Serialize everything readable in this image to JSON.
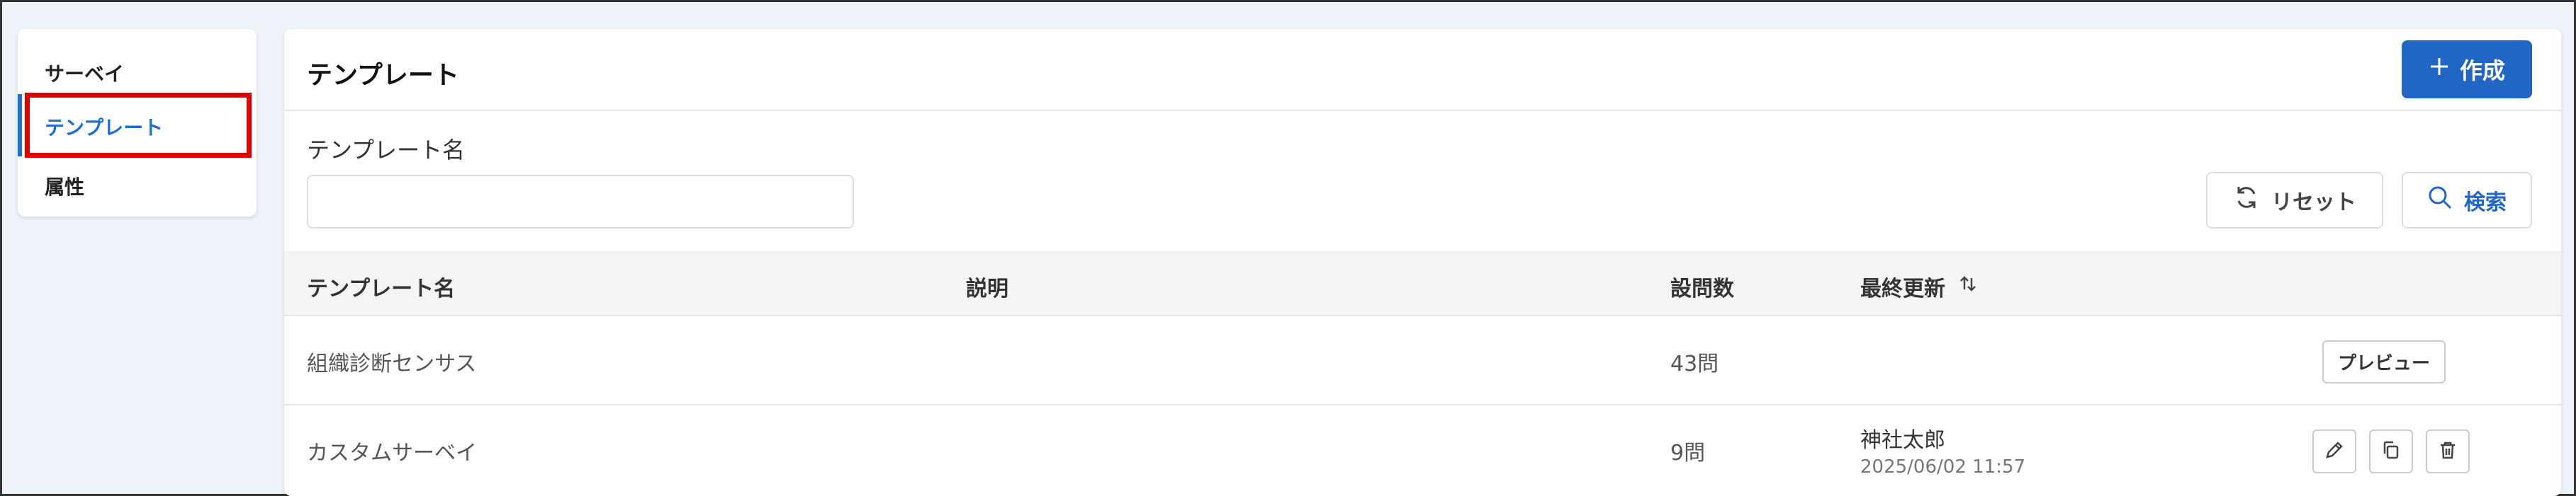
{
  "sidebar": {
    "items": [
      {
        "label": "サーベイ"
      },
      {
        "label": "テンプレート",
        "active": true
      },
      {
        "label": "属性"
      }
    ]
  },
  "header": {
    "title": "テンプレート",
    "create_label": "作成",
    "create_icon": "plus-icon"
  },
  "filter": {
    "name_label": "テンプレート名",
    "name_value": "",
    "name_placeholder": "",
    "reset_label": "リセット",
    "reset_icon": "refresh-icon",
    "search_label": "検索",
    "search_icon": "search-icon"
  },
  "table": {
    "columns": [
      "テンプレート名",
      "説明",
      "設問数",
      "最終更新"
    ],
    "sort_icon": "sort-icon",
    "rows": [
      {
        "name": "組織診断センサス",
        "description": "",
        "questions": "43問",
        "updated_by": "",
        "updated_at": "",
        "action": "プレビュー"
      },
      {
        "name": "カスタムサーベイ",
        "description": "",
        "questions": "9問",
        "updated_by": "神社太郎",
        "updated_at": "2025/06/02 11:57",
        "action_icons": [
          "edit-icon",
          "copy-icon",
          "trash-icon"
        ]
      }
    ]
  },
  "colors": {
    "accent": "#2166c4",
    "highlight": "#e00000",
    "background": "#eef3fa"
  }
}
